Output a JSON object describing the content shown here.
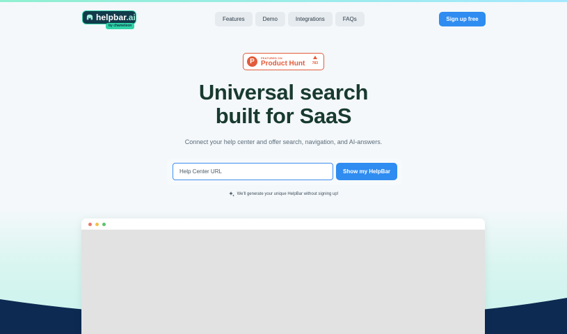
{
  "brand": {
    "name": "helpbar",
    "name_suffix": ".ai",
    "sub": "by chameleon"
  },
  "nav": {
    "items": [
      {
        "label": "Features"
      },
      {
        "label": "Demo"
      },
      {
        "label": "Integrations"
      },
      {
        "label": "FAQs"
      }
    ],
    "signup_label": "Sign up free"
  },
  "product_hunt": {
    "featured_on": "FEATURED ON",
    "name": "Product Hunt",
    "votes": "783"
  },
  "hero": {
    "headline_line1": "Universal search",
    "headline_line2": "built for SaaS",
    "subheadline": "Connect your help center and offer search, navigation, and AI-answers."
  },
  "form": {
    "input_placeholder": "Help Center URL",
    "button_label": "Show my HelpBar",
    "note": "We'll generate your unique HelpBar without signing up!"
  },
  "colors": {
    "accent": "#2f8cf0",
    "brand_dark": "#123a4a",
    "product_hunt": "#e25b3a",
    "headline": "#193a2f",
    "footer_wave": "#0d2a52"
  },
  "browser": {
    "dots": [
      "#e8776a",
      "#f2c14b",
      "#5cc36b"
    ]
  }
}
